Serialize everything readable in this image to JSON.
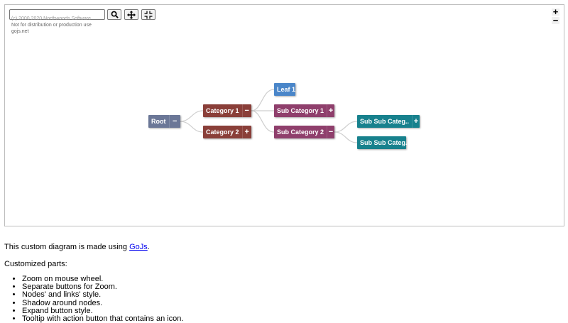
{
  "toolbar": {
    "search_placeholder": "",
    "search_icon": "search-icon",
    "pan_icon": "move-icon",
    "fit_icon": "fit-icon"
  },
  "watermark": {
    "line1": "(c) 2000 2020 Northwoods Software",
    "line2": "Not for distribution or production use",
    "line3": "gojs.net"
  },
  "zoom": {
    "in_label": "+",
    "out_label": "−"
  },
  "nodes": {
    "root": {
      "label": "Root",
      "button": "−",
      "color": "#6b7797"
    },
    "cat1": {
      "label": "Category 1",
      "button": "−",
      "color": "#8a3f39"
    },
    "cat2": {
      "label": "Category 2",
      "button": "+",
      "color": "#8a3f39"
    },
    "leaf1": {
      "label": "Leaf 1",
      "color": "#4a86c9"
    },
    "sub1": {
      "label": "Sub Category 1",
      "button": "+",
      "color": "#8f3f6c"
    },
    "sub2": {
      "label": "Sub Category 2",
      "button": "−",
      "color": "#8f3f6c"
    },
    "subsub1": {
      "label": "Sub Sub Categ..",
      "button": "+",
      "color": "#17818d"
    },
    "subsub2": {
      "label": "Sub Sub Categ..",
      "color": "#17818d"
    }
  },
  "content": {
    "intro_prefix": "This custom diagram is made using ",
    "intro_link": "GoJs",
    "intro_suffix": ".",
    "customized_heading": "Customized parts:",
    "items": [
      "Zoom on mouse wheel.",
      "Separate buttons for Zoom.",
      "Nodes' and links' style.",
      "Shadow around nodes.",
      "Expand button style.",
      "Tooltip with action button that contains an icon."
    ]
  }
}
